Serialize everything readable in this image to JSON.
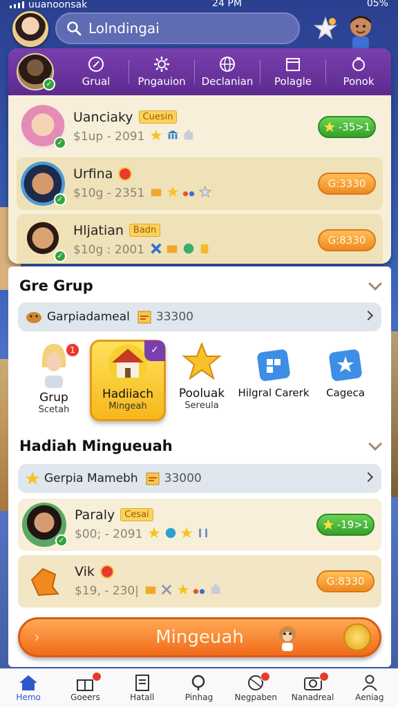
{
  "status_bar": {
    "carrier": "uuanoonsak",
    "time": "24 PM",
    "battery": "05%"
  },
  "search": {
    "placeholder": "Lolndingai"
  },
  "tabs": [
    {
      "label": "Grual",
      "icon": "compass-icon"
    },
    {
      "label": "Pngauion",
      "icon": "gear-icon"
    },
    {
      "label": "Declanian",
      "icon": "globe-icon"
    },
    {
      "label": "Polagle",
      "icon": "calendar-icon"
    },
    {
      "label": "Ponok",
      "icon": "badge-icon"
    }
  ],
  "top_rows": [
    {
      "name": "Uanciaky",
      "tag": "Cuesin",
      "sub": "$1up - 2091",
      "action": "-35>1",
      "action_style": "green"
    },
    {
      "name": "Urfina",
      "tag": "",
      "sub": "$10g - 2351",
      "action": "G:3330",
      "action_style": "orange"
    },
    {
      "name": "Hljatian",
      "tag": "Badn",
      "sub": "$10g : 2001",
      "action": "G:8330",
      "action_style": "orange"
    }
  ],
  "section_group": {
    "title": "Gre Grup",
    "bar_label": "Garpiadameal",
    "bar_value": "33300",
    "categories": [
      {
        "label": "Grup",
        "sub": "Scetah",
        "badge": "1",
        "icon": "avatar-icon",
        "selected": false
      },
      {
        "label": "Hadiiach",
        "sub": "Mingeah",
        "badge": "",
        "icon": "house-icon",
        "selected": true
      },
      {
        "label": "Pooluak",
        "sub": "Serеula",
        "badge": "",
        "icon": "star-icon",
        "selected": false
      },
      {
        "label": "Hilgral Carerk",
        "sub": "",
        "badge": "",
        "icon": "grid-icon",
        "selected": false
      },
      {
        "label": "Cageca",
        "sub": "",
        "badge": "",
        "icon": "star-box-icon",
        "selected": false
      }
    ]
  },
  "section_weekly": {
    "title": "Hadiah Mingueuah",
    "bar_label": "Gerpia Mamebh",
    "bar_value": "33000",
    "rows": [
      {
        "name": "Paraly",
        "tag": "Cesai",
        "sub": "$00; - 2091",
        "action": "-19>1",
        "action_style": "green"
      },
      {
        "name": "Vik",
        "tag": "",
        "sub": "$19, - 230|",
        "action": "G:8330",
        "action_style": "orange"
      }
    ]
  },
  "main_button": {
    "label": "Mingeuah"
  },
  "bottom_nav": [
    {
      "label": "Hemo",
      "icon": "home-icon",
      "active": true,
      "badge": false
    },
    {
      "label": "Goeers",
      "icon": "gift-icon",
      "active": false,
      "badge": true
    },
    {
      "label": "Hatall",
      "icon": "document-icon",
      "active": false,
      "badge": false
    },
    {
      "label": "Pinhag",
      "icon": "search-icon",
      "active": false,
      "badge": false
    },
    {
      "label": "Negpaben",
      "icon": "ball-icon",
      "active": false,
      "badge": true
    },
    {
      "label": "Nanadreal",
      "icon": "camera-icon",
      "active": false,
      "badge": true
    },
    {
      "label": "Aeniag",
      "icon": "person-icon",
      "active": false,
      "badge": false
    }
  ]
}
